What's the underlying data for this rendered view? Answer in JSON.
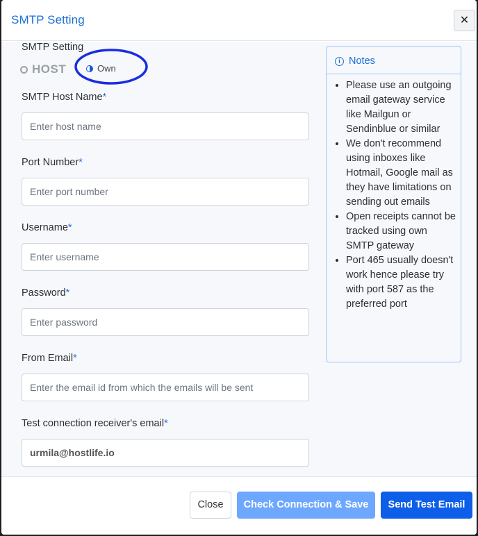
{
  "modal": {
    "title": "SMTP Setting",
    "close_icon": "close-icon"
  },
  "smtp_setting": {
    "label": "SMTP Setting",
    "options": [
      {
        "label": "HOST",
        "selected": false
      },
      {
        "label": "Own",
        "selected": true
      }
    ]
  },
  "fields": {
    "host": {
      "label": "SMTP Host Name",
      "required": "*",
      "placeholder": "Enter host name",
      "value": ""
    },
    "port": {
      "label": "Port Number",
      "required": "*",
      "placeholder": "Enter port number",
      "value": ""
    },
    "username": {
      "label": "Username",
      "required": "*",
      "placeholder": "Enter username",
      "value": ""
    },
    "password": {
      "label": "Password",
      "required": "*",
      "placeholder": "Enter password",
      "value": ""
    },
    "from_email": {
      "label": "From Email",
      "required": "*",
      "placeholder": "Enter the email id from which the emails will be sent",
      "value": ""
    },
    "test_email": {
      "label": "Test connection receiver's email",
      "required": "*",
      "placeholder": "",
      "value": "urmila@hostlife.io"
    }
  },
  "notes": {
    "title": "Notes",
    "icon": "info-icon",
    "items": [
      "Please use an outgoing email gateway service like Mailgun or Sendinblue or similar",
      "We don't recommend using inboxes like Hotmail, Google mail as they have limitations on sending out emails",
      "Open receipts cannot be tracked using own SMTP gateway",
      "Port 465 usually doesn't work hence please try with port 587 as the preferred port"
    ]
  },
  "footer": {
    "close_label": "Close",
    "check_label": "Check Connection & Save",
    "send_label": "Send Test Email"
  },
  "colors": {
    "title": "#1a6fd8",
    "primary": "#0d5ee8",
    "primary_light": "#6ea8fe",
    "annotation": "#1a2ee0"
  }
}
